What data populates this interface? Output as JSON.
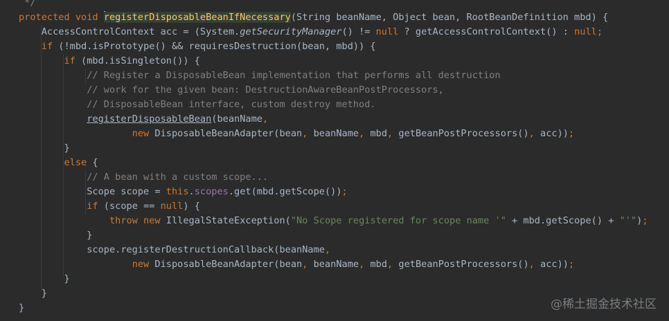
{
  "editor": {
    "theme_colors": {
      "background": "#2b2b2b",
      "default_text": "#a9b7c6",
      "keyword": "#cc7832",
      "comment": "#808080",
      "string": "#6a8759",
      "field": "#9876aa",
      "method_declaration": "#ffc66d",
      "identifier_highlight": "#344134"
    },
    "lines": [
      [
        {
          "t": " */",
          "c": "cm"
        }
      ],
      [
        {
          "t": "protected void ",
          "c": "kw"
        },
        {
          "t": "",
          "c": "caret"
        },
        {
          "t": "registerDisposableBeanIfNecessary",
          "c": "hl"
        },
        {
          "t": "(String beanName, Object bean, RootBeanDefinition mbd) {",
          "c": ""
        }
      ],
      [
        {
          "t": "    AccessControlContext acc = (System.",
          "c": ""
        },
        {
          "t": "getSecurityManager",
          "c": "it"
        },
        {
          "t": "() != ",
          "c": ""
        },
        {
          "t": "null",
          "c": "kw"
        },
        {
          "t": " ? getAccessControlContext() : ",
          "c": ""
        },
        {
          "t": "null",
          "c": "kw"
        },
        {
          "t": ";",
          "c": "kw"
        }
      ],
      [
        {
          "t": "    ",
          "c": ""
        },
        {
          "t": "if",
          "c": "kw"
        },
        {
          "t": " (!mbd.isPrototype() && requiresDestruction(bean, mbd)) {",
          "c": ""
        }
      ],
      [
        {
          "t": "        ",
          "c": ""
        },
        {
          "t": "if",
          "c": "kw"
        },
        {
          "t": " (mbd.isSingleton()) {",
          "c": ""
        }
      ],
      [
        {
          "t": "            // Register a DisposableBean implementation that performs all destruction",
          "c": "cm"
        }
      ],
      [
        {
          "t": "            // work for the given bean: DestructionAwareBeanPostProcessors,",
          "c": "cm"
        }
      ],
      [
        {
          "t": "            // DisposableBean interface, custom destroy method.",
          "c": "cm"
        }
      ],
      [
        {
          "t": "            ",
          "c": ""
        },
        {
          "t": "registerDisposableBean",
          "c": "lk"
        },
        {
          "t": "(beanName",
          "c": ""
        },
        {
          "t": ",",
          "c": "kw"
        }
      ],
      [
        {
          "t": "                    ",
          "c": ""
        },
        {
          "t": "new",
          "c": "kw"
        },
        {
          "t": " DisposableBeanAdapter(bean",
          "c": ""
        },
        {
          "t": ",",
          "c": "kw"
        },
        {
          "t": " beanName",
          "c": ""
        },
        {
          "t": ",",
          "c": "kw"
        },
        {
          "t": " mbd",
          "c": ""
        },
        {
          "t": ",",
          "c": "kw"
        },
        {
          "t": " getBeanPostProcessors()",
          "c": ""
        },
        {
          "t": ",",
          "c": "kw"
        },
        {
          "t": " acc))",
          "c": ""
        },
        {
          "t": ";",
          "c": "kw"
        }
      ],
      [
        {
          "t": "        }",
          "c": ""
        }
      ],
      [
        {
          "t": "        ",
          "c": ""
        },
        {
          "t": "else",
          "c": "kw"
        },
        {
          "t": " {",
          "c": ""
        }
      ],
      [
        {
          "t": "            // A bean with a custom scope...",
          "c": "cm"
        }
      ],
      [
        {
          "t": "            Scope scope = ",
          "c": ""
        },
        {
          "t": "this",
          "c": "kw"
        },
        {
          "t": ".",
          "c": ""
        },
        {
          "t": "scopes",
          "c": "fd"
        },
        {
          "t": ".get(mbd.getScope())",
          "c": ""
        },
        {
          "t": ";",
          "c": "kw"
        }
      ],
      [
        {
          "t": "            ",
          "c": ""
        },
        {
          "t": "if",
          "c": "kw"
        },
        {
          "t": " (scope == ",
          "c": ""
        },
        {
          "t": "null",
          "c": "kw"
        },
        {
          "t": ") {",
          "c": ""
        }
      ],
      [
        {
          "t": "                ",
          "c": ""
        },
        {
          "t": "throw new",
          "c": "kw"
        },
        {
          "t": " IllegalStateException(",
          "c": ""
        },
        {
          "t": "\"No Scope registered for scope name '\"",
          "c": "st"
        },
        {
          "t": " + mbd.getScope() + ",
          "c": ""
        },
        {
          "t": "\"'\"",
          "c": "st"
        },
        {
          "t": ")",
          "c": ""
        },
        {
          "t": ";",
          "c": "kw"
        }
      ],
      [
        {
          "t": "            }",
          "c": ""
        }
      ],
      [
        {
          "t": "            scope.registerDestructionCallback(beanName",
          "c": ""
        },
        {
          "t": ",",
          "c": "kw"
        }
      ],
      [
        {
          "t": "                    ",
          "c": ""
        },
        {
          "t": "new",
          "c": "kw"
        },
        {
          "t": " DisposableBeanAdapter(bean",
          "c": ""
        },
        {
          "t": ",",
          "c": "kw"
        },
        {
          "t": " beanName",
          "c": ""
        },
        {
          "t": ",",
          "c": "kw"
        },
        {
          "t": " mbd",
          "c": ""
        },
        {
          "t": ",",
          "c": "kw"
        },
        {
          "t": " getBeanPostProcessors()",
          "c": ""
        },
        {
          "t": ",",
          "c": "kw"
        },
        {
          "t": " acc))",
          "c": ""
        },
        {
          "t": ";",
          "c": "kw"
        }
      ],
      [
        {
          "t": "        }",
          "c": ""
        }
      ],
      [
        {
          "t": "    }",
          "c": ""
        }
      ],
      [
        {
          "t": "}",
          "c": ""
        }
      ]
    ]
  },
  "watermark": {
    "text": "@稀土掘金技术社区"
  }
}
